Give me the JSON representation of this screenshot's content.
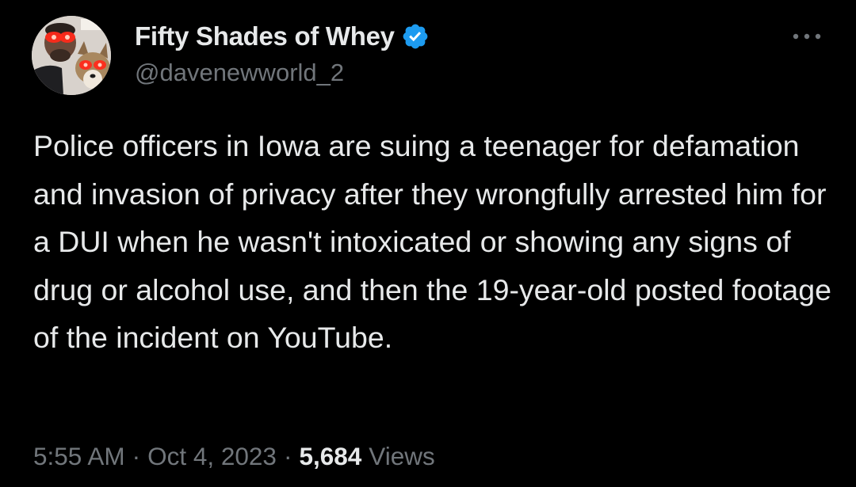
{
  "tweet": {
    "display_name": "Fifty Shades of Whey",
    "handle": "@davenewworld_2",
    "verified": true,
    "verified_color": "#1d9bf0",
    "text": "Police officers in Iowa are suing a teenager for defamation and invasion of privacy after they wrongfully arrested him for a DUI when he wasn't intoxicated or showing any signs of drug or alcohol use, and then the 19-year-old posted footage of the incident on YouTube.",
    "time": "5:55 AM",
    "separator": "·",
    "date": "Oct 4, 2023",
    "views_count": "5,684",
    "views_label": "Views"
  },
  "icons": {
    "avatar": "avatar-photo-with-dog",
    "verified": "verified-badge-icon",
    "more": "more-horizontal-icon"
  },
  "colors": {
    "background": "#000000",
    "primary_text": "#e7e9ea",
    "secondary_text": "#71767b"
  }
}
